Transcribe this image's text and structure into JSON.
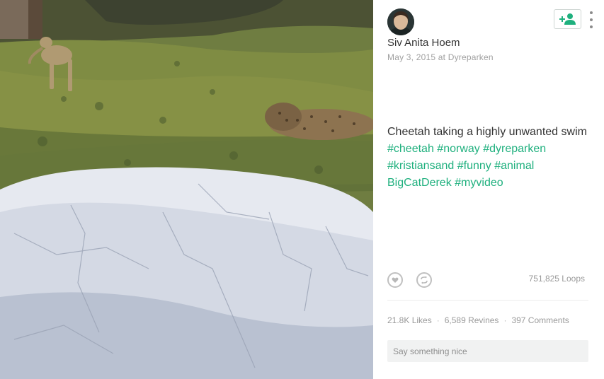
{
  "post": {
    "author": "Siv Anita Hoem",
    "date_place": "May 3, 2015 at Dyreparken",
    "description_text": "Cheetah taking a highly unwanted swim",
    "tags": [
      "#cheetah",
      "#norway",
      "#dyreparken",
      "#kristiansand",
      "#funny",
      "#animal",
      "BigCatDerek",
      "#myvideo"
    ]
  },
  "actions": {
    "follow_icon": "add-user-icon",
    "more_icon": "kebab-menu-icon",
    "like_icon": "heart-icon",
    "revine_icon": "revine-icon"
  },
  "stats": {
    "loops": "751,825 Loops",
    "likes": "21.8K Likes",
    "revines": "6,589 Revines",
    "comments": "397 Comments"
  },
  "comment": {
    "placeholder": "Say something nice"
  },
  "colors": {
    "accent": "#1fb07e",
    "text": "#333333",
    "muted": "#9a9a9a"
  }
}
